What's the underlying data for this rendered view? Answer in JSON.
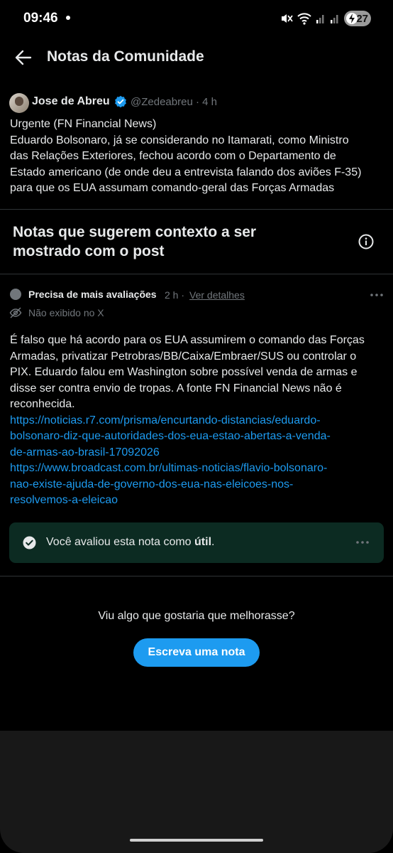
{
  "status_bar": {
    "time": "09:46",
    "battery": "27",
    "icons": [
      "mute-icon",
      "wifi-icon",
      "signal-icon",
      "signal-icon",
      "battery-icon"
    ]
  },
  "header": {
    "title": "Notas da Comunidade",
    "back_icon": "arrow-left-icon"
  },
  "post": {
    "author": "Jose de Abreu",
    "handle": "@Zedeabreu · 4 h",
    "lines": [
      "Urgente (FN Financial News)",
      "Eduardo Bolsonaro, já se considerando no Itamarati, como Ministro",
      "das Relações Exteriores, fechou acordo com o Departamento de",
      "Estado americano (de onde deu a entrevista falando dos aviões F-35)",
      "para que os EUA assumam comando-geral das Forças Armadas"
    ]
  },
  "notes_section": {
    "heading": "Notas que sugerem contexto a ser mostrado com o post",
    "heading_line1": "Notas que sugerem contexto a ser",
    "heading_line2": "mostrado com o post"
  },
  "note": {
    "status": "Precisa de mais avaliações",
    "time": "2 h ·",
    "details_link": "Ver detalhes",
    "visibility": "Não exibido no X",
    "text_lines": [
      "É falso que há acordo para os EUA assumirem o comando das Forças",
      "Armadas, privatizar Petrobras/BB/Caixa/Embraer/SUS ou controlar o",
      "PIX. Eduardo falou em Washington sobre possível venda de armas e",
      "disse ser contra envio de tropas. A fonte FN Financial News não é",
      "reconhecida."
    ],
    "link_lines": [
      "https://noticias.r7.com/prisma/encurtando-distancias/eduardo-",
      "bolsonaro-diz-que-autoridades-dos-eua-estao-abertas-a-venda-",
      "de-armas-ao-brasil-17092026",
      "https://www.broadcast.com.br/ultimas-noticias/flavio-bolsonaro-",
      "nao-existe-ajuda-de-governo-dos-eua-nas-eleicoes-nos-",
      "resolvemos-a-eleicao"
    ]
  },
  "rating": {
    "prefix": "Você avaliou esta nota como ",
    "value": "útil",
    "suffix": "."
  },
  "footer": {
    "question": "Viu algo que gostaria que melhorasse?",
    "button": "Escreva uma nota"
  },
  "colors": {
    "background": "#000000",
    "accent": "#1d9bf0",
    "muted": "#71767b",
    "rated_bg": "#0c2b22"
  }
}
